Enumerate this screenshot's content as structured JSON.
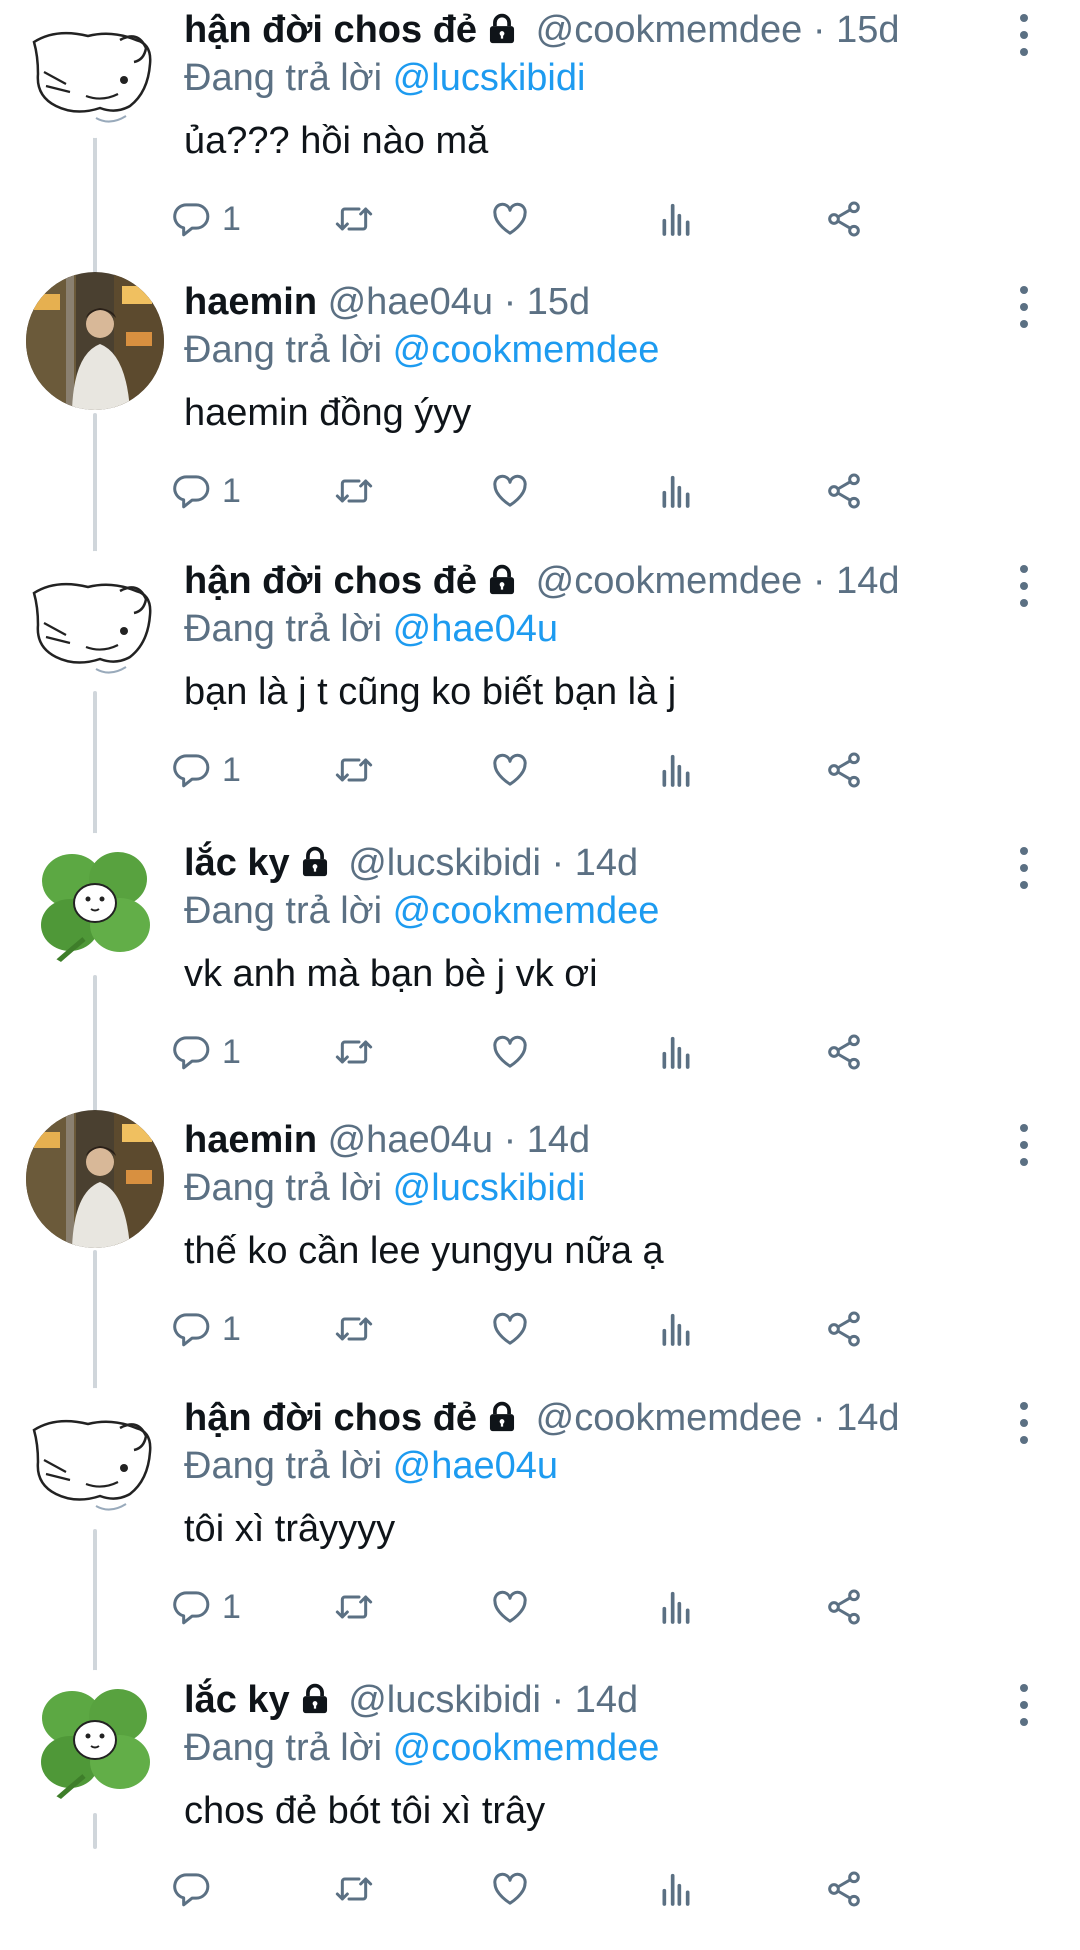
{
  "reply_prefix": "Đang trả lời",
  "tweets": [
    {
      "name": "hận đời chos đẻ",
      "protected": true,
      "handle": "@cookmemdee",
      "time": "15d",
      "reply_to": "@lucskibidi",
      "text": "ủa??? hồi nào mă",
      "reply_count": "1",
      "avatar": "sketch-dog"
    },
    {
      "name": "haemin",
      "protected": false,
      "handle": "@hae04u",
      "time": "15d",
      "reply_to": "@cookmemdee",
      "text": "haemin đồng ýyy",
      "reply_count": "1",
      "avatar": "photo-person"
    },
    {
      "name": "hận đời chos đẻ",
      "protected": true,
      "handle": "@cookmemdee",
      "time": "14d",
      "reply_to": "@hae04u",
      "text": "bạn là j t cũng ko biết bạn là j",
      "reply_count": "1",
      "avatar": "sketch-dog"
    },
    {
      "name": "lắc ky",
      "protected": true,
      "handle": "@lucskibidi",
      "time": "14d",
      "reply_to": "@cookmemdee",
      "text": "vk anh mà bạn bè j vk ơi",
      "reply_count": "1",
      "avatar": "four-leaf-clover"
    },
    {
      "name": "haemin",
      "protected": false,
      "handle": "@hae04u",
      "time": "14d",
      "reply_to": "@lucskibidi",
      "text": "thế ko cần lee yungyu nữa ạ",
      "reply_count": "1",
      "avatar": "photo-person"
    },
    {
      "name": "hận đời chos đẻ",
      "protected": true,
      "handle": "@cookmemdee",
      "time": "14d",
      "reply_to": "@hae04u",
      "text": "tôi xì trâyyyy",
      "reply_count": "1",
      "avatar": "sketch-dog"
    },
    {
      "name": "lắc ky",
      "protected": true,
      "handle": "@lucskibidi",
      "time": "14d",
      "reply_to": "@cookmemdee",
      "text": "chos đẻ bót tôi xì trây",
      "reply_count": "",
      "avatar": "four-leaf-clover"
    }
  ],
  "icons": {
    "reply": "reply-icon",
    "retweet": "retweet-icon",
    "like": "like-icon",
    "analytics": "analytics-icon",
    "share": "share-icon",
    "more": "more-icon",
    "lock": "lock-icon"
  },
  "colors": {
    "mention": "#1d9bf0",
    "secondary": "#5b7083",
    "thread": "#d0d6db"
  }
}
